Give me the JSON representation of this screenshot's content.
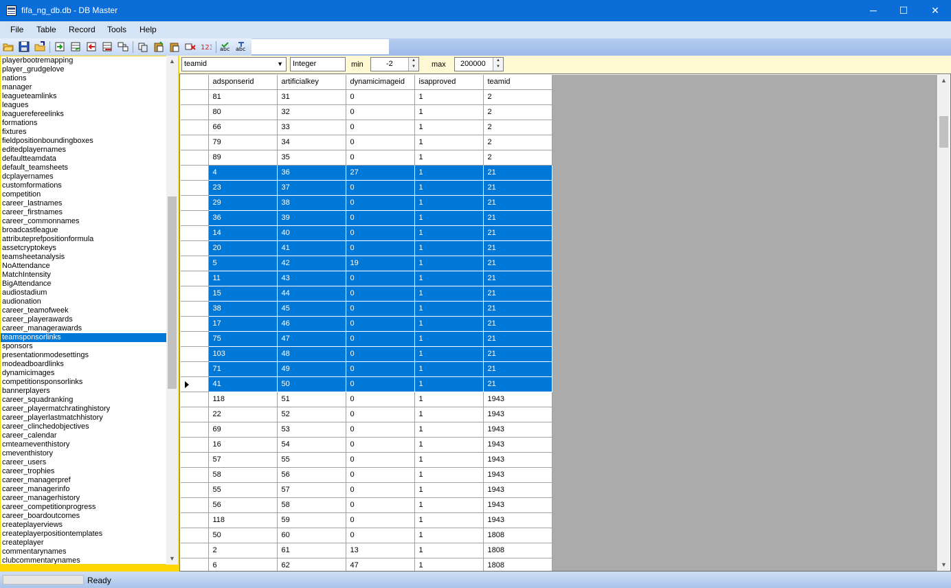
{
  "window": {
    "title": "fifa_ng_db.db - DB Master",
    "minimize": "─",
    "maximize": "☐",
    "close": "✕"
  },
  "menu": [
    "File",
    "Table",
    "Record",
    "Tools",
    "Help"
  ],
  "toolbar": {
    "buttons": [
      "open-folder-icon",
      "save-icon",
      "export-icon",
      "import-green-icon",
      "import-table-icon",
      "export-red-icon",
      "delete-table-icon",
      "compare-icon",
      "copy-icon",
      "paste-icon",
      "paste-special-icon",
      "delete-record-icon",
      "number-format-icon",
      "spellcheck-icon",
      "spellcheck-alt-icon"
    ],
    "search_value": ""
  },
  "tables": [
    "playerbootremapping",
    "player_grudgelove",
    "nations",
    "manager",
    "leagueteamlinks",
    "leagues",
    "leaguerefereelinks",
    "formations",
    "fixtures",
    "fieldpositionboundingboxes",
    "editedplayernames",
    "defaultteamdata",
    "default_teamsheets",
    "dcplayernames",
    "customformations",
    "competition",
    "career_lastnames",
    "career_firstnames",
    "career_commonnames",
    "broadcastleague",
    "attributeprefpositionformula",
    "assetcryptokeys",
    "teamsheetanalysis",
    "NoAttendance",
    "MatchIntensity",
    "BigAttendance",
    "audiostadium",
    "audionation",
    "career_teamofweek",
    "career_playerawards",
    "career_managerawards",
    "teamsponsorlinks",
    "sponsors",
    "presentationmodesettings",
    "modeadboardlinks",
    "dynamicimages",
    "competitionsponsorlinks",
    "bannerplayers",
    "career_squadranking",
    "career_playermatchratinghistory",
    "career_playerlastmatchhistory",
    "career_clinchedobjectives",
    "career_calendar",
    "cmteameventhistory",
    "cmeventhistory",
    "career_users",
    "career_trophies",
    "career_managerpref",
    "career_managerinfo",
    "career_managerhistory",
    "career_competitionprogress",
    "career_boardoutcomes",
    "createplayerviews",
    "createplayerpositiontemplates",
    "createplayer",
    "commentarynames",
    "clubcommentarynames"
  ],
  "selected_table": "teamsponsorlinks",
  "filter": {
    "field": "teamid",
    "type": "Integer",
    "min_label": "min",
    "min_value": "-2",
    "max_label": "max",
    "max_value": "200000"
  },
  "grid": {
    "columns": [
      "adsponserid",
      "artificialkey",
      "dynamicimageid",
      "isapproved",
      "teamid"
    ],
    "rows": [
      {
        "values": [
          "81",
          "31",
          "0",
          "1",
          "2"
        ],
        "selected": false
      },
      {
        "values": [
          "80",
          "32",
          "0",
          "1",
          "2"
        ],
        "selected": false
      },
      {
        "values": [
          "66",
          "33",
          "0",
          "1",
          "2"
        ],
        "selected": false
      },
      {
        "values": [
          "79",
          "34",
          "0",
          "1",
          "2"
        ],
        "selected": false
      },
      {
        "values": [
          "89",
          "35",
          "0",
          "1",
          "2"
        ],
        "selected": false
      },
      {
        "values": [
          "4",
          "36",
          "27",
          "1",
          "21"
        ],
        "selected": true
      },
      {
        "values": [
          "23",
          "37",
          "0",
          "1",
          "21"
        ],
        "selected": true
      },
      {
        "values": [
          "29",
          "38",
          "0",
          "1",
          "21"
        ],
        "selected": true
      },
      {
        "values": [
          "36",
          "39",
          "0",
          "1",
          "21"
        ],
        "selected": true
      },
      {
        "values": [
          "14",
          "40",
          "0",
          "1",
          "21"
        ],
        "selected": true
      },
      {
        "values": [
          "20",
          "41",
          "0",
          "1",
          "21"
        ],
        "selected": true
      },
      {
        "values": [
          "5",
          "42",
          "19",
          "1",
          "21"
        ],
        "selected": true
      },
      {
        "values": [
          "11",
          "43",
          "0",
          "1",
          "21"
        ],
        "selected": true
      },
      {
        "values": [
          "15",
          "44",
          "0",
          "1",
          "21"
        ],
        "selected": true
      },
      {
        "values": [
          "38",
          "45",
          "0",
          "1",
          "21"
        ],
        "selected": true
      },
      {
        "values": [
          "17",
          "46",
          "0",
          "1",
          "21"
        ],
        "selected": true
      },
      {
        "values": [
          "75",
          "47",
          "0",
          "1",
          "21"
        ],
        "selected": true
      },
      {
        "values": [
          "103",
          "48",
          "0",
          "1",
          "21"
        ],
        "selected": true
      },
      {
        "values": [
          "71",
          "49",
          "0",
          "1",
          "21"
        ],
        "selected": true
      },
      {
        "values": [
          "41",
          "50",
          "0",
          "1",
          "21"
        ],
        "selected": true,
        "current": true
      },
      {
        "values": [
          "118",
          "51",
          "0",
          "1",
          "1943"
        ],
        "selected": false
      },
      {
        "values": [
          "22",
          "52",
          "0",
          "1",
          "1943"
        ],
        "selected": false
      },
      {
        "values": [
          "69",
          "53",
          "0",
          "1",
          "1943"
        ],
        "selected": false
      },
      {
        "values": [
          "16",
          "54",
          "0",
          "1",
          "1943"
        ],
        "selected": false
      },
      {
        "values": [
          "57",
          "55",
          "0",
          "1",
          "1943"
        ],
        "selected": false
      },
      {
        "values": [
          "58",
          "56",
          "0",
          "1",
          "1943"
        ],
        "selected": false
      },
      {
        "values": [
          "55",
          "57",
          "0",
          "1",
          "1943"
        ],
        "selected": false
      },
      {
        "values": [
          "56",
          "58",
          "0",
          "1",
          "1943"
        ],
        "selected": false
      },
      {
        "values": [
          "118",
          "59",
          "0",
          "1",
          "1943"
        ],
        "selected": false
      },
      {
        "values": [
          "50",
          "60",
          "0",
          "1",
          "1808"
        ],
        "selected": false
      },
      {
        "values": [
          "2",
          "61",
          "13",
          "1",
          "1808"
        ],
        "selected": false
      },
      {
        "values": [
          "6",
          "62",
          "47",
          "1",
          "1808"
        ],
        "selected": false
      }
    ]
  },
  "status": {
    "text": "Ready"
  },
  "colors": {
    "titlebar": "#0a6dd8",
    "selection": "#0078d7",
    "panel_accent": "#ffd700",
    "filter_bg": "#fff9d3"
  }
}
